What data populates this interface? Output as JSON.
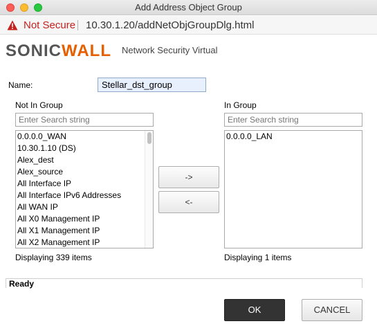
{
  "window": {
    "title": "Add Address Object Group"
  },
  "urlbar": {
    "security_label": "Not Secure",
    "url": "10.30.1.20/addNetObjGroupDlg.html"
  },
  "header": {
    "logo_left": "SONIC",
    "logo_right": "WALL",
    "subtitle": "Network Security Virtual"
  },
  "form": {
    "name_label": "Name:",
    "name_value": "Stellar_dst_group",
    "not_in_group": {
      "heading": "Not In Group",
      "search_placeholder": "Enter Search string",
      "items": [
        "0.0.0.0_WAN",
        "10.30.1.10 (DS)",
        "Alex_dest",
        "Alex_source",
        "All Interface IP",
        "All Interface IPv6 Addresses",
        "All WAN IP",
        "All X0 Management IP",
        "All X1 Management IP",
        "All X2 Management IP"
      ],
      "count_text": "Displaying 339 items"
    },
    "in_group": {
      "heading": "In Group",
      "search_placeholder": "Enter Search string",
      "items": [
        "0.0.0.0_LAN"
      ],
      "count_text": "Displaying 1 items"
    },
    "add_button": "->",
    "remove_button": "<-"
  },
  "status": {
    "text": "Ready"
  },
  "buttons": {
    "ok": "OK",
    "cancel": "CANCEL"
  },
  "colors": {
    "brand_orange": "#e65f00",
    "insecure_red": "#c5221f",
    "ok_button": "#333333"
  }
}
